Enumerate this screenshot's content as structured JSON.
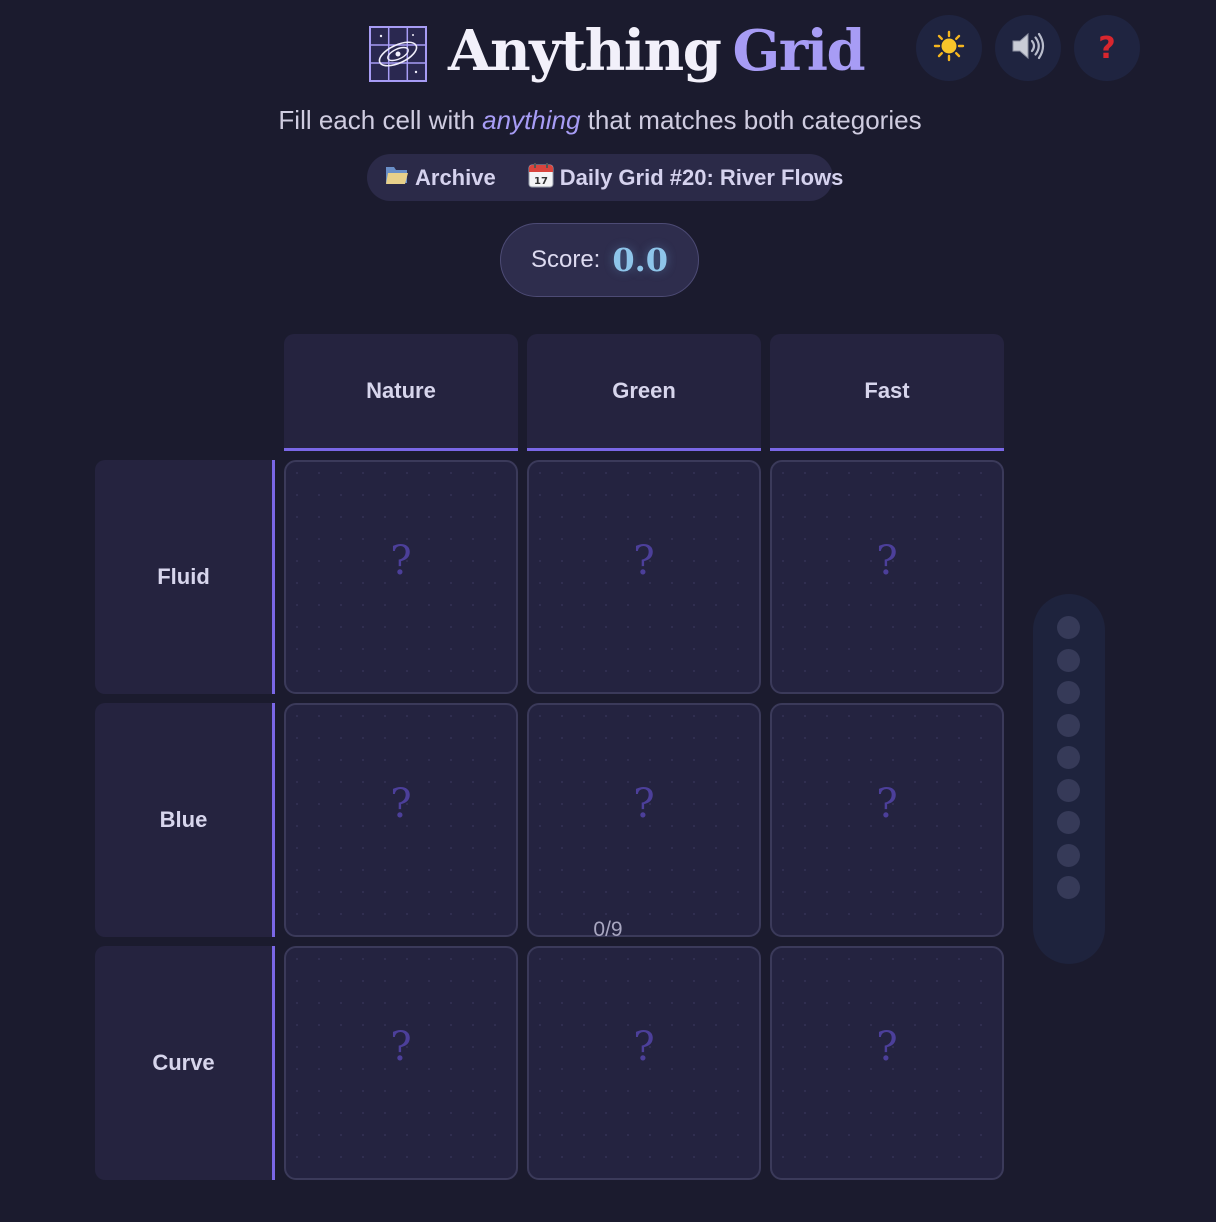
{
  "header": {
    "title_word1": "Anything",
    "title_word2": "Grid",
    "subtitle_before": "Fill each cell with",
    "subtitle_emphasis": "anything",
    "subtitle_after": "that matches both categories"
  },
  "toolbar": {
    "theme_icon": "sun-icon",
    "sound_icon": "speaker-icon",
    "help_label": "?"
  },
  "nav": {
    "archive_label": "Archive",
    "archive_icon": "folder-icon",
    "daily_label": "Daily Grid #20: River Flows",
    "daily_icon": "calendar-icon",
    "calendar_day": "17"
  },
  "score": {
    "label": "Score:",
    "value": "0.0"
  },
  "grid": {
    "columns": [
      "Nature",
      "Green",
      "Fast"
    ],
    "rows": [
      "Fluid",
      "Blue",
      "Curve"
    ],
    "cells": [
      [
        "?",
        "?",
        "?"
      ],
      [
        "?",
        "?",
        "?"
      ],
      [
        "?",
        "?",
        "?"
      ]
    ]
  },
  "progress": {
    "filled": 0,
    "total": 9,
    "label": "0/9"
  },
  "colors": {
    "background": "#1b1b2e",
    "accent": "#a79cf5",
    "score": "#8ec5ea",
    "header_underline": "#7a67e6"
  }
}
